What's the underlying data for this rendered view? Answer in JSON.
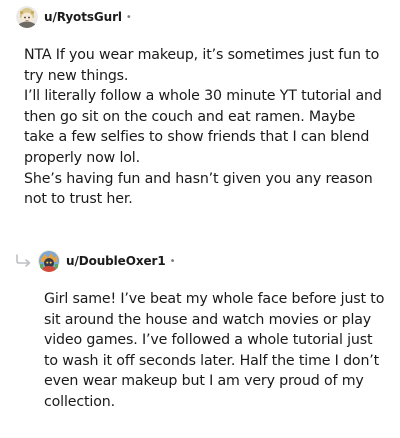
{
  "comment": {
    "username": "u/RyotsGurl",
    "separator": "•",
    "paragraphs": [
      "NTA If you wear makeup, it’s sometimes just fun to try new things.",
      "I’ll literally follow a whole 30 minute YT tutorial and then go sit on the couch and eat ramen. Maybe take a few selfies to show friends that I can blend properly now lol.",
      "She’s having fun and hasn’t given you any reason not to trust her."
    ]
  },
  "reply": {
    "username": "u/DoubleOxer1",
    "separator": "•",
    "paragraphs": [
      "Girl same! I’ve beat my whole face before just to sit around the house and watch movies or play video games. I’ve followed a whole tutorial just to wash it off seconds later. Half the time I don’t even wear makeup but I am very proud of my collection."
    ]
  },
  "icons": {
    "comment_avatar": "avatar-icon",
    "reply_avatar": "avatar-icon",
    "reply_arrow": "reply-arrow-icon"
  }
}
